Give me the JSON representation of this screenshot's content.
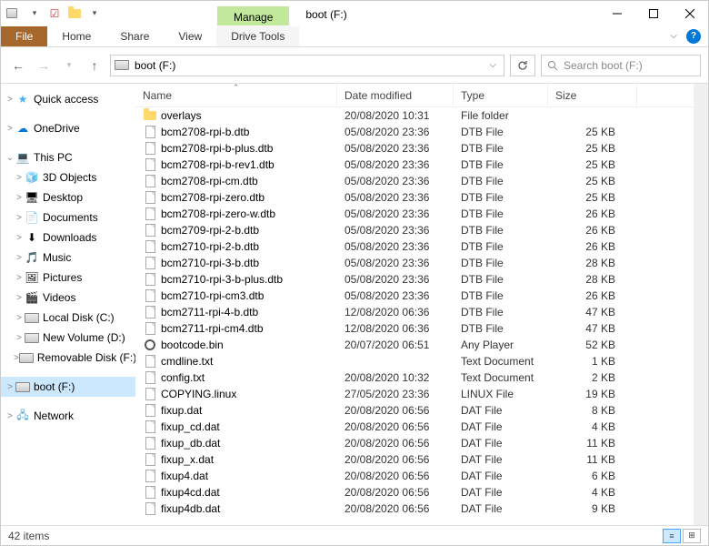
{
  "title_tabs": {
    "manage": "Manage",
    "boot": "boot (F:)"
  },
  "ribbon": {
    "file": "File",
    "home": "Home",
    "share": "Share",
    "view": "View",
    "drive_tools": "Drive Tools"
  },
  "address": "boot (F:)",
  "search_placeholder": "Search boot (F:)",
  "headers": {
    "name": "Name",
    "date": "Date modified",
    "type": "Type",
    "size": "Size"
  },
  "nav": {
    "quick_access": "Quick access",
    "onedrive": "OneDrive",
    "this_pc": "This PC",
    "objects3d": "3D Objects",
    "desktop": "Desktop",
    "documents": "Documents",
    "downloads": "Downloads",
    "music": "Music",
    "pictures": "Pictures",
    "videos": "Videos",
    "local_disk": "Local Disk (C:)",
    "new_volume": "New Volume (D:)",
    "removable": "Removable Disk (F:)",
    "boot": "boot (F:)",
    "network": "Network"
  },
  "files": [
    {
      "name": "overlays",
      "date": "20/08/2020 10:31",
      "type": "File folder",
      "size": "",
      "icon": "folder"
    },
    {
      "name": "bcm2708-rpi-b.dtb",
      "date": "05/08/2020 23:36",
      "type": "DTB File",
      "size": "25 KB",
      "icon": "doc"
    },
    {
      "name": "bcm2708-rpi-b-plus.dtb",
      "date": "05/08/2020 23:36",
      "type": "DTB File",
      "size": "25 KB",
      "icon": "doc"
    },
    {
      "name": "bcm2708-rpi-b-rev1.dtb",
      "date": "05/08/2020 23:36",
      "type": "DTB File",
      "size": "25 KB",
      "icon": "doc"
    },
    {
      "name": "bcm2708-rpi-cm.dtb",
      "date": "05/08/2020 23:36",
      "type": "DTB File",
      "size": "25 KB",
      "icon": "doc"
    },
    {
      "name": "bcm2708-rpi-zero.dtb",
      "date": "05/08/2020 23:36",
      "type": "DTB File",
      "size": "25 KB",
      "icon": "doc"
    },
    {
      "name": "bcm2708-rpi-zero-w.dtb",
      "date": "05/08/2020 23:36",
      "type": "DTB File",
      "size": "26 KB",
      "icon": "doc"
    },
    {
      "name": "bcm2709-rpi-2-b.dtb",
      "date": "05/08/2020 23:36",
      "type": "DTB File",
      "size": "26 KB",
      "icon": "doc"
    },
    {
      "name": "bcm2710-rpi-2-b.dtb",
      "date": "05/08/2020 23:36",
      "type": "DTB File",
      "size": "26 KB",
      "icon": "doc"
    },
    {
      "name": "bcm2710-rpi-3-b.dtb",
      "date": "05/08/2020 23:36",
      "type": "DTB File",
      "size": "28 KB",
      "icon": "doc"
    },
    {
      "name": "bcm2710-rpi-3-b-plus.dtb",
      "date": "05/08/2020 23:36",
      "type": "DTB File",
      "size": "28 KB",
      "icon": "doc"
    },
    {
      "name": "bcm2710-rpi-cm3.dtb",
      "date": "05/08/2020 23:36",
      "type": "DTB File",
      "size": "26 KB",
      "icon": "doc"
    },
    {
      "name": "bcm2711-rpi-4-b.dtb",
      "date": "12/08/2020 06:36",
      "type": "DTB File",
      "size": "47 KB",
      "icon": "doc"
    },
    {
      "name": "bcm2711-rpi-cm4.dtb",
      "date": "12/08/2020 06:36",
      "type": "DTB File",
      "size": "47 KB",
      "icon": "doc"
    },
    {
      "name": "bootcode.bin",
      "date": "20/07/2020 06:51",
      "type": "Any Player",
      "size": "52 KB",
      "icon": "gear"
    },
    {
      "name": "cmdline.txt",
      "date": "",
      "type": "Text Document",
      "size": "1 KB",
      "icon": "doc"
    },
    {
      "name": "config.txt",
      "date": "20/08/2020 10:32",
      "type": "Text Document",
      "size": "2 KB",
      "icon": "doc"
    },
    {
      "name": "COPYING.linux",
      "date": "27/05/2020 23:36",
      "type": "LINUX File",
      "size": "19 KB",
      "icon": "doc"
    },
    {
      "name": "fixup.dat",
      "date": "20/08/2020 06:56",
      "type": "DAT File",
      "size": "8 KB",
      "icon": "doc"
    },
    {
      "name": "fixup_cd.dat",
      "date": "20/08/2020 06:56",
      "type": "DAT File",
      "size": "4 KB",
      "icon": "doc"
    },
    {
      "name": "fixup_db.dat",
      "date": "20/08/2020 06:56",
      "type": "DAT File",
      "size": "11 KB",
      "icon": "doc"
    },
    {
      "name": "fixup_x.dat",
      "date": "20/08/2020 06:56",
      "type": "DAT File",
      "size": "11 KB",
      "icon": "doc"
    },
    {
      "name": "fixup4.dat",
      "date": "20/08/2020 06:56",
      "type": "DAT File",
      "size": "6 KB",
      "icon": "doc"
    },
    {
      "name": "fixup4cd.dat",
      "date": "20/08/2020 06:56",
      "type": "DAT File",
      "size": "4 KB",
      "icon": "doc"
    },
    {
      "name": "fixup4db.dat",
      "date": "20/08/2020 06:56",
      "type": "DAT File",
      "size": "9 KB",
      "icon": "doc"
    }
  ],
  "status": "42 items"
}
